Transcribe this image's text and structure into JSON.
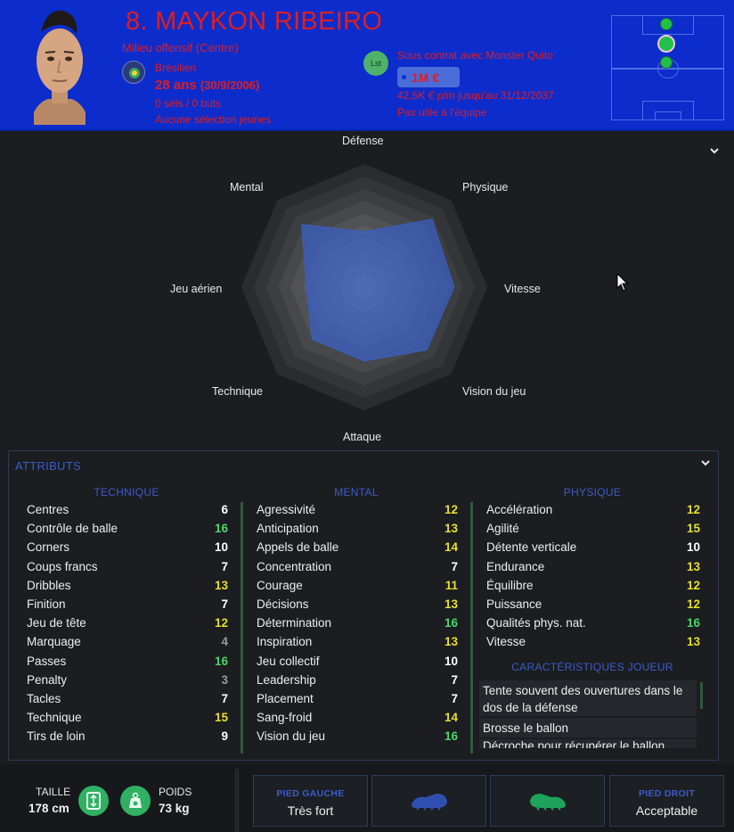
{
  "header": {
    "name": "8. MAYKON RIBEIRO",
    "position": "Milieu offensif (Centre)",
    "nationality": "Brésilien",
    "age": "28 ans",
    "dob": "(30/9/2006)",
    "caps": "0 séls / 0 buts",
    "youth": "Aucune sélection jeunes",
    "list_badge": "Lst",
    "contract": "Sous contrat avec Monster Quito",
    "value": "1M €",
    "wage": "42,5K € p/m jusqu'au 31/12/2037",
    "status": "Pas utile à l'équipe"
  },
  "radar": {
    "labels": {
      "defense": "Défense",
      "physique": "Physique",
      "vitesse": "Vitesse",
      "vision": "Vision du jeu",
      "attaque": "Attaque",
      "technique": "Technique",
      "aerien": "Jeu aérien",
      "mental": "Mental"
    },
    "values": {
      "defense": 0.45,
      "physique": 0.78,
      "vitesse": 0.73,
      "vision": 0.72,
      "attaque": 0.6,
      "technique": 0.6,
      "aerien": 0.47,
      "mental": 0.72
    }
  },
  "attributes": {
    "title": "ATTRIBUTS",
    "technique": {
      "heading": "TECHNIQUE",
      "rows": [
        {
          "name": "Centres",
          "value": "6",
          "color": "#ffffff"
        },
        {
          "name": "Contrôle de balle",
          "value": "16",
          "color": "#4dd66a"
        },
        {
          "name": "Corners",
          "value": "10",
          "color": "#ffffff"
        },
        {
          "name": "Coups francs",
          "value": "7",
          "color": "#ffffff"
        },
        {
          "name": "Dribbles",
          "value": "13",
          "color": "#e6df2e"
        },
        {
          "name": "Finition",
          "value": "7",
          "color": "#ffffff"
        },
        {
          "name": "Jeu de tête",
          "value": "12",
          "color": "#e6df2e"
        },
        {
          "name": "Marquage",
          "value": "4",
          "color": "#9a9a9a"
        },
        {
          "name": "Passes",
          "value": "16",
          "color": "#4dd66a"
        },
        {
          "name": "Penalty",
          "value": "3",
          "color": "#9a9a9a"
        },
        {
          "name": "Tacles",
          "value": "7",
          "color": "#ffffff"
        },
        {
          "name": "Technique",
          "value": "15",
          "color": "#e6df2e"
        },
        {
          "name": "Tirs de loin",
          "value": "9",
          "color": "#ffffff"
        }
      ]
    },
    "mental": {
      "heading": "MENTAL",
      "rows": [
        {
          "name": "Agressivité",
          "value": "12",
          "color": "#e6df2e"
        },
        {
          "name": "Anticipation",
          "value": "13",
          "color": "#e6df2e"
        },
        {
          "name": "Appels de balle",
          "value": "14",
          "color": "#e6df2e"
        },
        {
          "name": "Concentration",
          "value": "7",
          "color": "#ffffff"
        },
        {
          "name": "Courage",
          "value": "11",
          "color": "#e6df2e"
        },
        {
          "name": "Décisions",
          "value": "13",
          "color": "#e6df2e"
        },
        {
          "name": "Détermination",
          "value": "16",
          "color": "#4dd66a"
        },
        {
          "name": "Inspiration",
          "value": "13",
          "color": "#e6df2e"
        },
        {
          "name": "Jeu collectif",
          "value": "10",
          "color": "#ffffff"
        },
        {
          "name": "Leadership",
          "value": "7",
          "color": "#ffffff"
        },
        {
          "name": "Placement",
          "value": "7",
          "color": "#ffffff"
        },
        {
          "name": "Sang-froid",
          "value": "14",
          "color": "#e6df2e"
        },
        {
          "name": "Vision du jeu",
          "value": "16",
          "color": "#4dd66a"
        }
      ]
    },
    "physique": {
      "heading": "PHYSIQUE",
      "rows": [
        {
          "name": "Accélération",
          "value": "12",
          "color": "#e6df2e"
        },
        {
          "name": "Agilité",
          "value": "15",
          "color": "#e6df2e"
        },
        {
          "name": "Détente verticale",
          "value": "10",
          "color": "#ffffff"
        },
        {
          "name": "Endurance",
          "value": "13",
          "color": "#e6df2e"
        },
        {
          "name": "Équilibre",
          "value": "12",
          "color": "#e6df2e"
        },
        {
          "name": "Puissance",
          "value": "12",
          "color": "#e6df2e"
        },
        {
          "name": "Qualités phys. nat.",
          "value": "16",
          "color": "#4dd66a"
        },
        {
          "name": "Vitesse",
          "value": "13",
          "color": "#e6df2e"
        }
      ]
    },
    "traits": {
      "heading": "CARACTÉRISTIQUES JOUEUR",
      "items": [
        "Tente souvent des ouvertures dans le dos de la défense",
        "Brosse le ballon",
        "Décroche pour récupérer le ballon"
      ]
    }
  },
  "footer": {
    "height_label": "TAILLE",
    "height_value": "178 cm",
    "weight_label": "POIDS",
    "weight_value": "73 kg",
    "left_foot_label": "PIED GAUCHE",
    "left_foot_value": "Très fort",
    "right_foot_label": "PIED DROIT",
    "right_foot_value": "Acceptable"
  },
  "colors": {
    "header_bg": "#0d2ccc",
    "header_text": "#e01e1e",
    "accent_blue": "#3d5cc9",
    "good": "#4dd66a",
    "ok": "#e6df2e"
  }
}
